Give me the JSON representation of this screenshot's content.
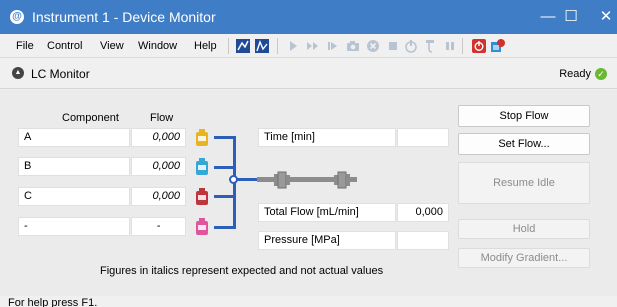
{
  "window": {
    "title": "Instrument 1 - Device Monitor",
    "minimize_glyph": "—",
    "maximize_glyph": "☐",
    "close_glyph": "✕"
  },
  "menu": {
    "items": [
      {
        "label": "File"
      },
      {
        "label": "Control"
      },
      {
        "label": "View"
      },
      {
        "label": "Window"
      },
      {
        "label": "Help"
      }
    ]
  },
  "toolbar": {
    "icons": [
      "graph-icon",
      "calibrate-icon",
      "play-icon",
      "fast-forward-icon",
      "step-icon",
      "snapshot-icon",
      "abort-icon",
      "stop-icon",
      "smart-shutdown-icon",
      "pour-icon",
      "pause-icon",
      "emergency-stop-icon",
      "instrument-config-icon"
    ]
  },
  "panel": {
    "title": "LC Monitor",
    "status": "Ready",
    "status_color": "#69b832"
  },
  "table": {
    "header_component": "Component",
    "header_flow": "Flow",
    "rows": [
      {
        "component": "A",
        "flow": "0,000",
        "bottle_color": "#e8b422"
      },
      {
        "component": "B",
        "flow": "0,000",
        "bottle_color": "#35a8d8"
      },
      {
        "component": "C",
        "flow": "0,000",
        "bottle_color": "#c0353d"
      },
      {
        "component": "-",
        "flow": "-",
        "bottle_color": "#e0559c"
      }
    ]
  },
  "readouts": {
    "time_label": "Time [min]",
    "time_value": "",
    "total_flow_label": "Total Flow [mL/min]",
    "total_flow_value": "0,000",
    "pressure_label": "Pressure [MPa]",
    "pressure_value": ""
  },
  "buttons": {
    "stop_flow": "Stop Flow",
    "set_flow": "Set Flow...",
    "resume_idle": "Resume Idle",
    "hold": "Hold",
    "modify_gradient": "Modify Gradient..."
  },
  "footnote": "Figures in italics represent expected and not actual values",
  "statusbar": {
    "text": "For help press F1."
  },
  "colors": {
    "titlebar": "#3f7ec6",
    "pipe": "#2e5fb8"
  }
}
